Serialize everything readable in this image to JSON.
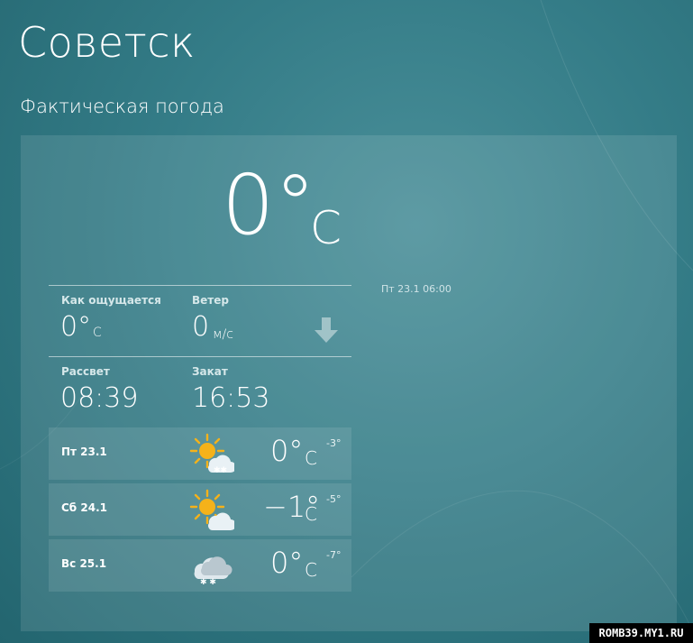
{
  "header": {
    "city": "Советск",
    "subtitle": "Фактическая погода"
  },
  "current": {
    "temperature": "0°",
    "unit": "C",
    "feels_like": {
      "label": "Как ощущается",
      "value": "0°",
      "unit": "C"
    },
    "wind": {
      "label": "Ветер",
      "value": "0",
      "unit": "м/с",
      "direction_icon": "arrow-down-icon"
    },
    "sunrise": {
      "label": "Рассвет",
      "value": "08:39"
    },
    "sunset": {
      "label": "Закат",
      "value": "16:53"
    },
    "updated": "Пт 23.1 06:00"
  },
  "forecast": [
    {
      "day": "Пт 23.1",
      "icon": "partly-cloudy-snow-icon",
      "temp": "0°",
      "unit": "C",
      "min": "-3°"
    },
    {
      "day": "Сб 24.1",
      "icon": "partly-cloudy-icon",
      "temp": "−1°",
      "unit": "C",
      "min": "-5°"
    },
    {
      "day": "Вс 25.1",
      "icon": "cloud-snow-icon",
      "temp": "0°",
      "unit": "C",
      "min": "-7°"
    }
  ],
  "watermark": "ROMB39.MY1.RU",
  "colors": {
    "background": "#347c87",
    "panel": "rgba(255,255,255,0.11)",
    "sun": "#f5b21a",
    "cloud": "#e9f1f5"
  }
}
